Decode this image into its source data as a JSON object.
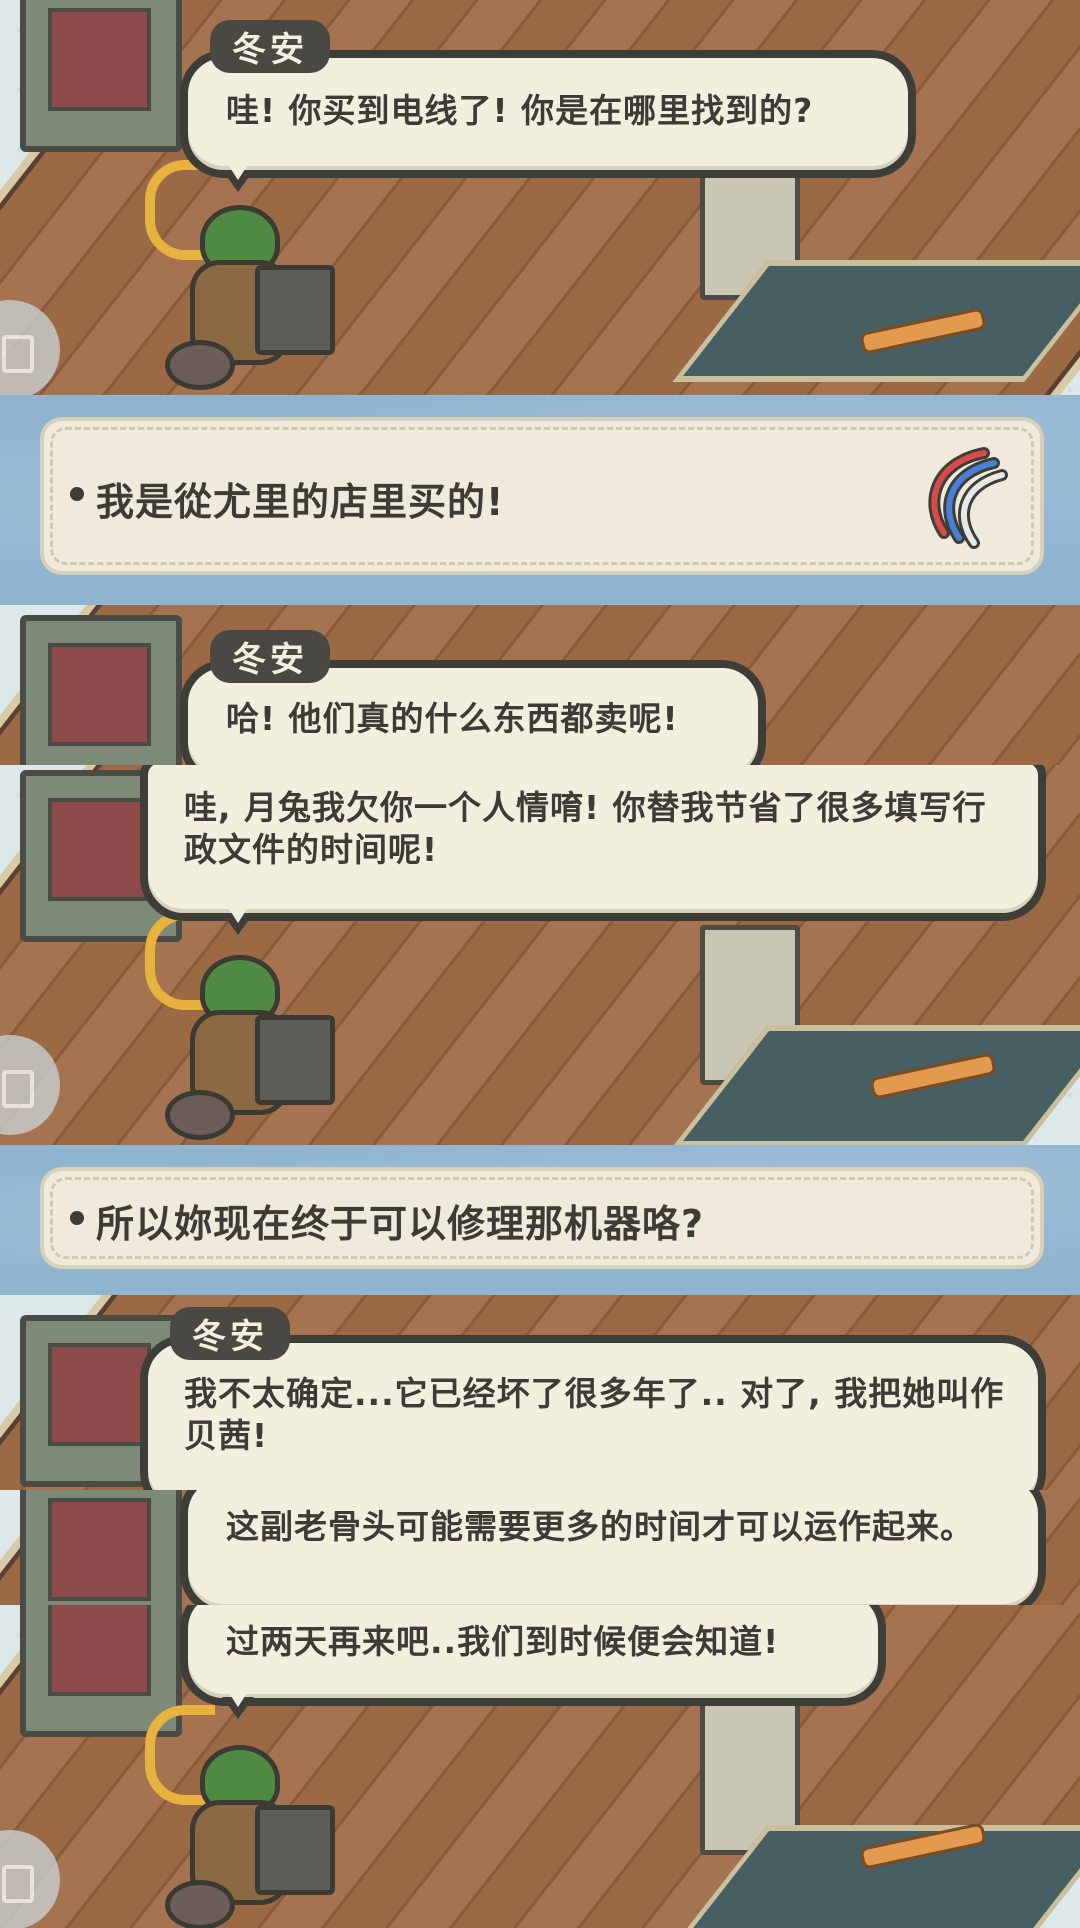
{
  "speaker": "冬安",
  "dialogue": {
    "line1": "哇! 你买到电线了! 你是在哪里找到的?",
    "line2": "哈! 他们真的什么东西都卖呢!",
    "line3": "哇, 月兔我欠你一个人情唷! 你替我节省了很多填写行政文件的时间呢!",
    "line4": "我不太确定...它已经坏了很多年了.. 对了, 我把她叫作贝茜!",
    "line5": "这副老骨头可能需要更多的时间才可以运作起来。",
    "line6": "过两天再来吧..我们到时候便会知道!"
  },
  "choices": {
    "choice1": "我是從尤里的店里买的!",
    "choice2": "所以妳现在终于可以修理那机器咯?"
  },
  "icons": {
    "choice1_item": "cable-bundle-icon",
    "side_button": "menu-icon"
  },
  "colors": {
    "bubble_fill": "#f2efdf",
    "bubble_border": "#3e3e38",
    "choice_background": "#8fb4d0",
    "nametag": "#4a4843"
  }
}
